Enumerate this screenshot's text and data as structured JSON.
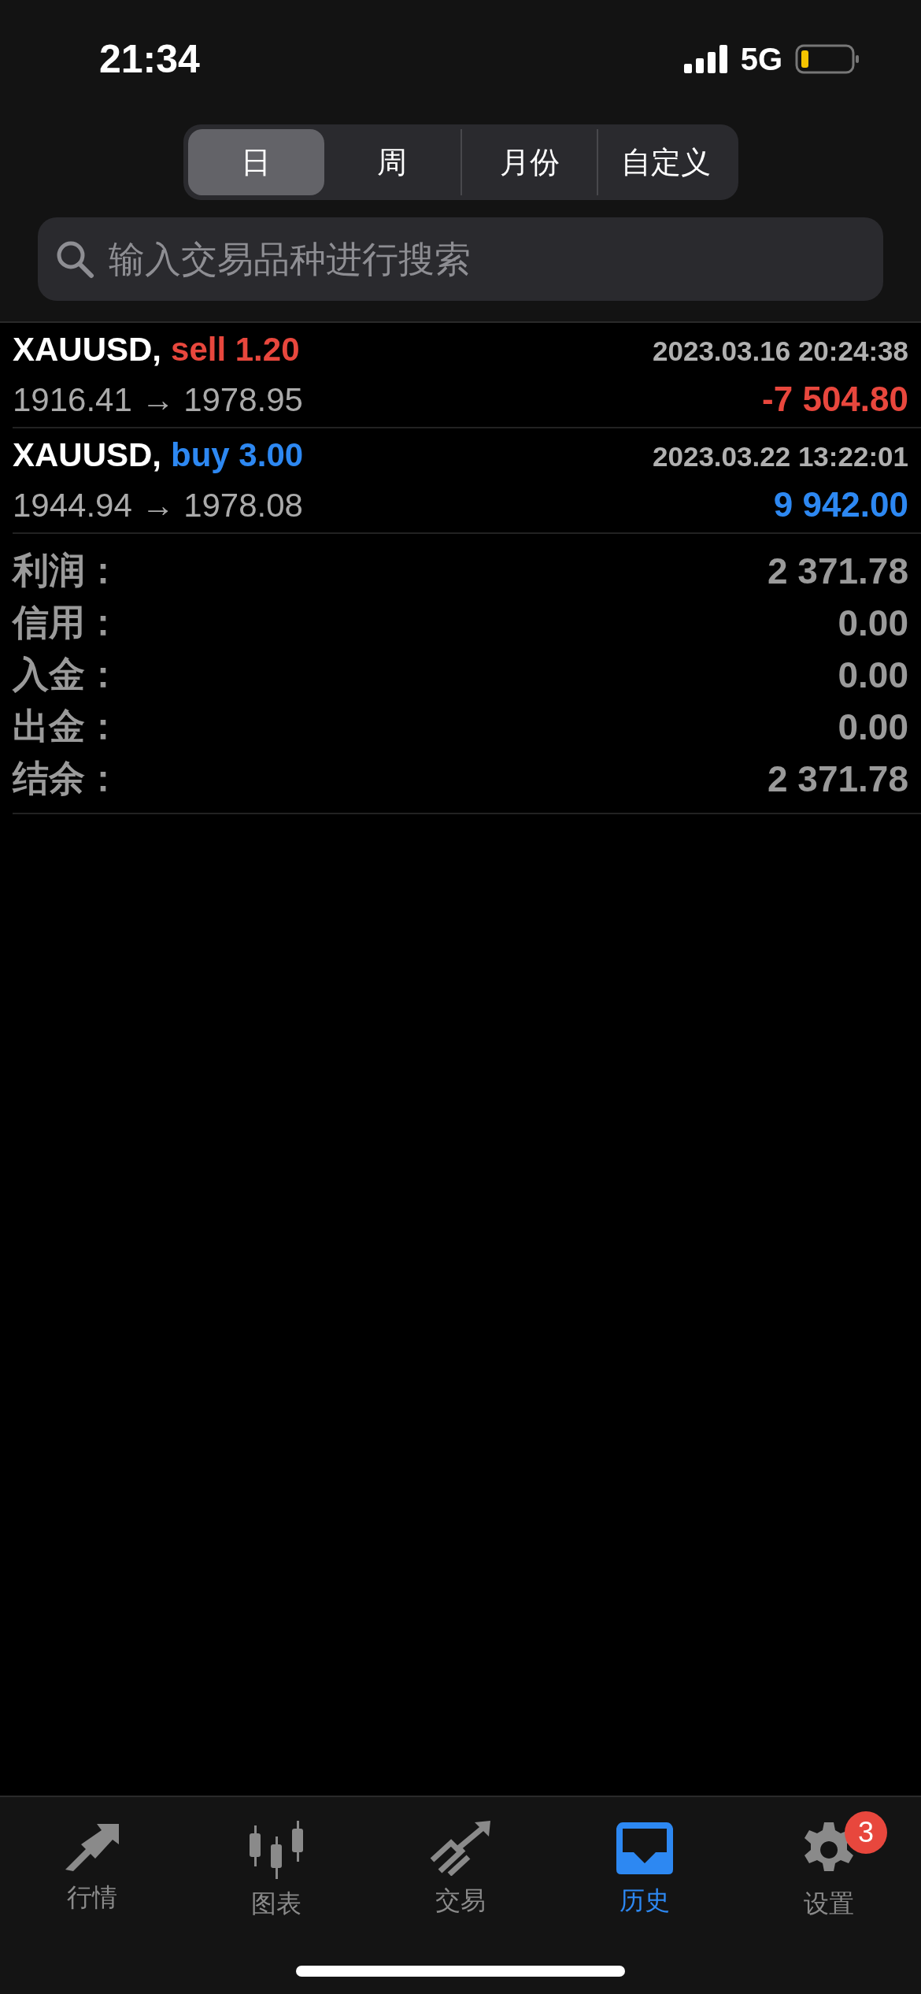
{
  "status_bar": {
    "time": "21:34",
    "network": "5G"
  },
  "period_tabs": [
    {
      "label": "日",
      "selected": true
    },
    {
      "label": "周",
      "selected": false
    },
    {
      "label": "月份",
      "selected": false
    },
    {
      "label": "自定义",
      "selected": false
    }
  ],
  "search": {
    "placeholder": "输入交易品种进行搜索"
  },
  "trades": [
    {
      "symbol": "XAUUSD,",
      "kind": "sell",
      "side": "sell 1.20",
      "time": "2023.03.16 20:24:38",
      "prices": "1916.41 → 1978.95",
      "profit": "-7 504.80"
    },
    {
      "symbol": "XAUUSD,",
      "kind": "buy",
      "side": "buy 3.00",
      "time": "2023.03.22 13:22:01",
      "prices": "1944.94 → 1978.08",
      "profit": "9 942.00"
    }
  ],
  "summary": [
    {
      "label": "利润：",
      "value": "2 371.78"
    },
    {
      "label": "信用：",
      "value": "0.00"
    },
    {
      "label": "入金：",
      "value": "0.00"
    },
    {
      "label": "出金：",
      "value": "0.00"
    },
    {
      "label": "结余：",
      "value": "2 371.78"
    }
  ],
  "tab_bar": [
    {
      "label": "行情",
      "selected": false
    },
    {
      "label": "图表",
      "selected": false
    },
    {
      "label": "交易",
      "selected": false
    },
    {
      "label": "历史",
      "selected": true
    },
    {
      "label": "设置",
      "selected": false,
      "badge": "3"
    }
  ]
}
